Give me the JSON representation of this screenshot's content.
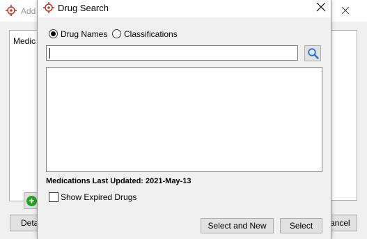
{
  "background_window": {
    "title": "Add",
    "medication_label": "Medica",
    "details_button": "Deta",
    "cancel_button": "ancel",
    "add_icon": "plus-circle-icon"
  },
  "dialog": {
    "title": "Drug Search",
    "app_icon": "crosshair-logo-icon",
    "search_mode": {
      "options": [
        {
          "label": "Drug Names",
          "selected": true
        },
        {
          "label": "Classifications",
          "selected": false
        }
      ]
    },
    "search": {
      "value": "",
      "placeholder": "",
      "icon": "magnifier-icon"
    },
    "results": [],
    "last_updated_text": "Medications Last Updated: 2021-May-13",
    "show_expired": {
      "label": "Show Expired Drugs",
      "checked": false
    },
    "buttons": {
      "select_and_new": "Select and New",
      "select": "Select"
    }
  },
  "colors": {
    "logo_red": "#c0392b",
    "add_green": "#22a31c",
    "search_blue": "#2a6fc9"
  }
}
